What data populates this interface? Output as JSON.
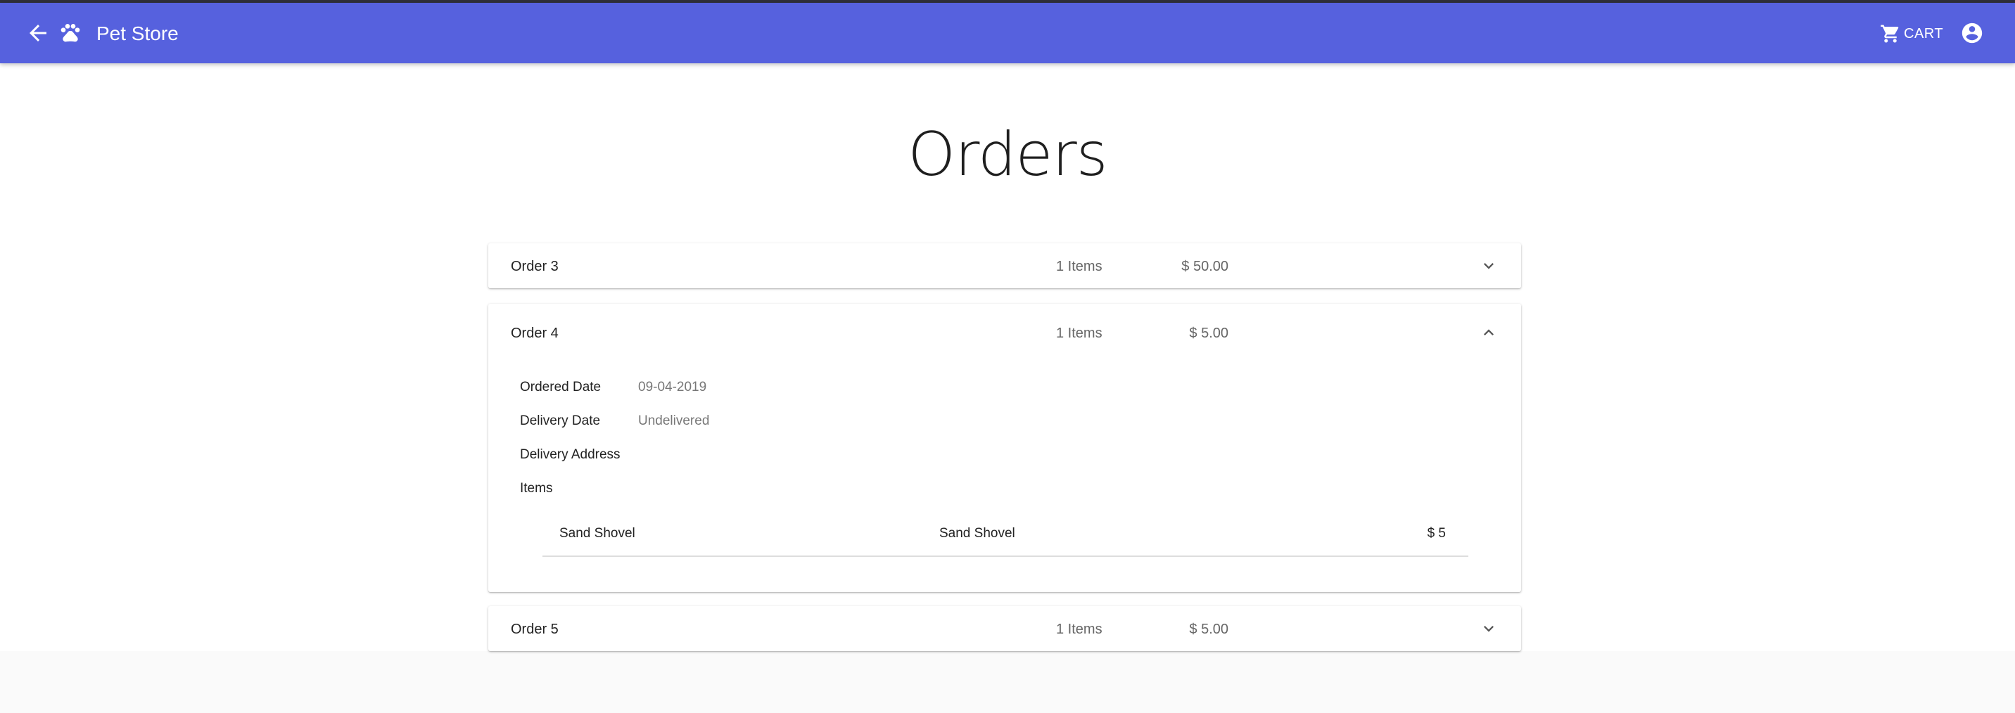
{
  "appbar": {
    "title": "Pet Store",
    "cart_label": "CART",
    "back_icon": "arrow-back-icon",
    "logo_icon": "paw-icon",
    "cart_icon": "shopping-cart-icon",
    "account_icon": "account-circle-icon",
    "color": "#5661de"
  },
  "page": {
    "title": "Orders"
  },
  "orders": [
    {
      "name": "Order 3",
      "items": "1 Items",
      "price": "$ 50.00",
      "expanded": false
    },
    {
      "name": "Order 4",
      "items": "1 Items",
      "price": "$ 5.00",
      "expanded": true,
      "details": {
        "ordered_date_label": "Ordered Date",
        "ordered_date": "09-04-2019",
        "delivery_date_label": "Delivery Date",
        "delivery_date": "Undelivered",
        "delivery_address_label": "Delivery Address",
        "items_label": "Items",
        "line_items": [
          {
            "name": "Sand Shovel",
            "description": "Sand Shovel",
            "price": "$ 5"
          }
        ]
      }
    },
    {
      "name": "Order 5",
      "items": "1 Items",
      "price": "$ 5.00",
      "expanded": false
    }
  ]
}
